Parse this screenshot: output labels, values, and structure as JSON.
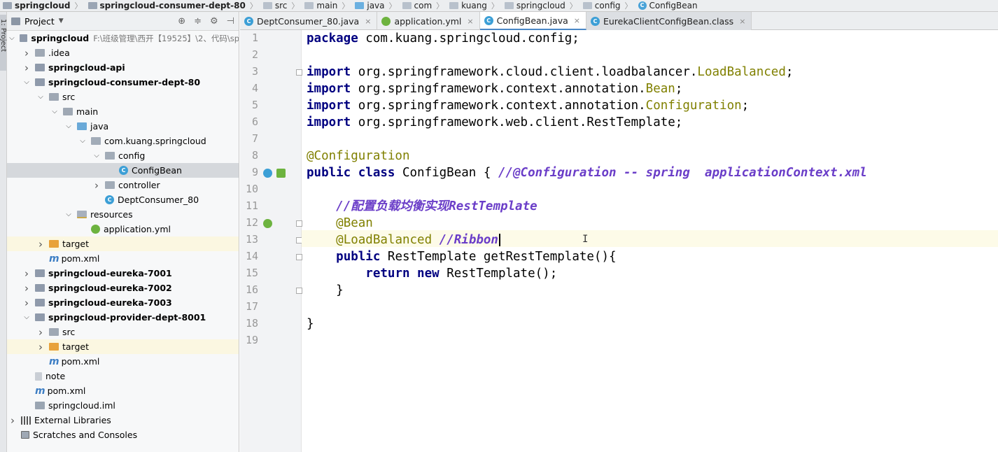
{
  "breadcrumb": {
    "items": [
      "springcloud",
      "springcloud-consumer-dept-80",
      "src",
      "main",
      "java",
      "com",
      "kuang",
      "springcloud",
      "config",
      "ConfigBean"
    ]
  },
  "side_strip": {
    "label": "1: Project"
  },
  "project_panel": {
    "title": "Project",
    "root_path": "F:\\班级管理\\西开【19525】\\2、代码\\sp",
    "tree": [
      {
        "label": "springcloud",
        "bold": true,
        "icon": "module-icon",
        "arrow": "▼",
        "depth": 0
      },
      {
        "label": ".idea",
        "icon": "folder-icon",
        "arrow": "▶",
        "depth": 1
      },
      {
        "label": "springcloud-api",
        "bold": true,
        "icon": "module-icon",
        "arrow": "▶",
        "depth": 1
      },
      {
        "label": "springcloud-consumer-dept-80",
        "bold": true,
        "icon": "module-icon",
        "arrow": "▼",
        "depth": 1
      },
      {
        "label": "src",
        "icon": "folder-icon",
        "arrow": "▼",
        "depth": 2
      },
      {
        "label": "main",
        "icon": "folder-icon",
        "arrow": "▼",
        "depth": 3
      },
      {
        "label": "java",
        "icon": "source-folder-icon",
        "arrow": "▼",
        "depth": 4
      },
      {
        "label": "com.kuang.springcloud",
        "icon": "package-icon",
        "arrow": "▼",
        "depth": 5
      },
      {
        "label": "config",
        "icon": "package-icon",
        "arrow": "▼",
        "depth": 6
      },
      {
        "label": "ConfigBean",
        "icon": "class-icon",
        "arrow": "",
        "depth": 7,
        "selected": true
      },
      {
        "label": "controller",
        "icon": "package-icon",
        "arrow": "▶",
        "depth": 6
      },
      {
        "label": "DeptConsumer_80",
        "icon": "spring-boot-class-icon",
        "arrow": "",
        "depth": 6
      },
      {
        "label": "resources",
        "icon": "resources-folder-icon",
        "arrow": "▼",
        "depth": 4
      },
      {
        "label": "application.yml",
        "icon": "spring-yml-icon",
        "arrow": "",
        "depth": 5
      },
      {
        "label": "target",
        "icon": "target-folder-icon",
        "arrow": "▶",
        "depth": 2,
        "highlight": true
      },
      {
        "label": "pom.xml",
        "icon": "maven-icon",
        "arrow": "",
        "depth": 2
      },
      {
        "label": "springcloud-eureka-7001",
        "bold": true,
        "icon": "module-icon",
        "arrow": "▶",
        "depth": 1
      },
      {
        "label": "springcloud-eureka-7002",
        "bold": true,
        "icon": "module-icon",
        "arrow": "▶",
        "depth": 1
      },
      {
        "label": "springcloud-eureka-7003",
        "bold": true,
        "icon": "module-icon",
        "arrow": "▶",
        "depth": 1
      },
      {
        "label": "springcloud-provider-dept-8001",
        "bold": true,
        "icon": "module-icon",
        "arrow": "▼",
        "depth": 1
      },
      {
        "label": "src",
        "icon": "folder-icon",
        "arrow": "▶",
        "depth": 2
      },
      {
        "label": "target",
        "icon": "target-folder-icon",
        "arrow": "▶",
        "depth": 2,
        "highlight": true
      },
      {
        "label": "pom.xml",
        "icon": "maven-icon",
        "arrow": "",
        "depth": 2
      },
      {
        "label": "note",
        "icon": "text-file-icon",
        "arrow": "",
        "depth": 1
      },
      {
        "label": "pom.xml",
        "icon": "maven-icon",
        "arrow": "",
        "depth": 1
      },
      {
        "label": "springcloud.iml",
        "icon": "iml-file-icon",
        "arrow": "",
        "depth": 1
      },
      {
        "label": "External Libraries",
        "icon": "library-icon",
        "arrow": "▶",
        "depth": 0
      },
      {
        "label": "Scratches and Consoles",
        "icon": "scratches-icon",
        "arrow": "",
        "depth": 0
      }
    ]
  },
  "editor_tabs": [
    {
      "label": "DeptConsumer_80.java",
      "icon": "spring-boot-class-icon",
      "closable": true,
      "active": false
    },
    {
      "label": "application.yml",
      "icon": "spring-yml-icon",
      "closable": true,
      "active": false
    },
    {
      "label": "ConfigBean.java",
      "icon": "class-icon",
      "closable": true,
      "active": true
    },
    {
      "label": "EurekaClientConfigBean.class",
      "icon": "class-icon",
      "closable": true,
      "active": false
    }
  ],
  "editor": {
    "current_line": 13,
    "lines": [
      [
        {
          "t": "package ",
          "c": "kw"
        },
        {
          "t": "com.kuang.springcloud.config;",
          "c": ""
        }
      ],
      [],
      [
        {
          "t": "import ",
          "c": "kw"
        },
        {
          "t": "org.springframework.cloud.client.loadbalancer.",
          "c": ""
        },
        {
          "t": "LoadBalanced",
          "c": "ann"
        },
        {
          "t": ";",
          "c": ""
        }
      ],
      [
        {
          "t": "import ",
          "c": "kw"
        },
        {
          "t": "org.springframework.context.annotation.",
          "c": ""
        },
        {
          "t": "Bean",
          "c": "ann"
        },
        {
          "t": ";",
          "c": ""
        }
      ],
      [
        {
          "t": "import ",
          "c": "kw"
        },
        {
          "t": "org.springframework.context.annotation.",
          "c": ""
        },
        {
          "t": "Configuration",
          "c": "ann"
        },
        {
          "t": ";",
          "c": ""
        }
      ],
      [
        {
          "t": "import ",
          "c": "kw"
        },
        {
          "t": "org.springframework.web.client.RestTemplate;",
          "c": ""
        }
      ],
      [],
      [
        {
          "t": "@Configuration",
          "c": "ann"
        }
      ],
      [
        {
          "t": "public class ",
          "c": "kw"
        },
        {
          "t": "ConfigBean { ",
          "c": ""
        },
        {
          "t": "//@Configuration -- spring  applicationContext.xml",
          "c": "cm"
        }
      ],
      [],
      [
        {
          "t": "    ",
          "c": ""
        },
        {
          "t": "//配置负载均衡实现RestTemplate",
          "c": "cm"
        }
      ],
      [
        {
          "t": "    ",
          "c": ""
        },
        {
          "t": "@Bean",
          "c": "ann"
        }
      ],
      [
        {
          "t": "    ",
          "c": ""
        },
        {
          "t": "@LoadBalanced ",
          "c": "ann"
        },
        {
          "t": "//Ribbon",
          "c": "cm"
        }
      ],
      [
        {
          "t": "    ",
          "c": ""
        },
        {
          "t": "public ",
          "c": "kw"
        },
        {
          "t": "RestTemplate getRestTemplate(){",
          "c": ""
        }
      ],
      [
        {
          "t": "        ",
          "c": ""
        },
        {
          "t": "return new ",
          "c": "kw"
        },
        {
          "t": "RestTemplate();",
          "c": ""
        }
      ],
      [
        {
          "t": "    }",
          "c": ""
        }
      ],
      [],
      [
        {
          "t": "}",
          "c": ""
        }
      ],
      []
    ]
  }
}
